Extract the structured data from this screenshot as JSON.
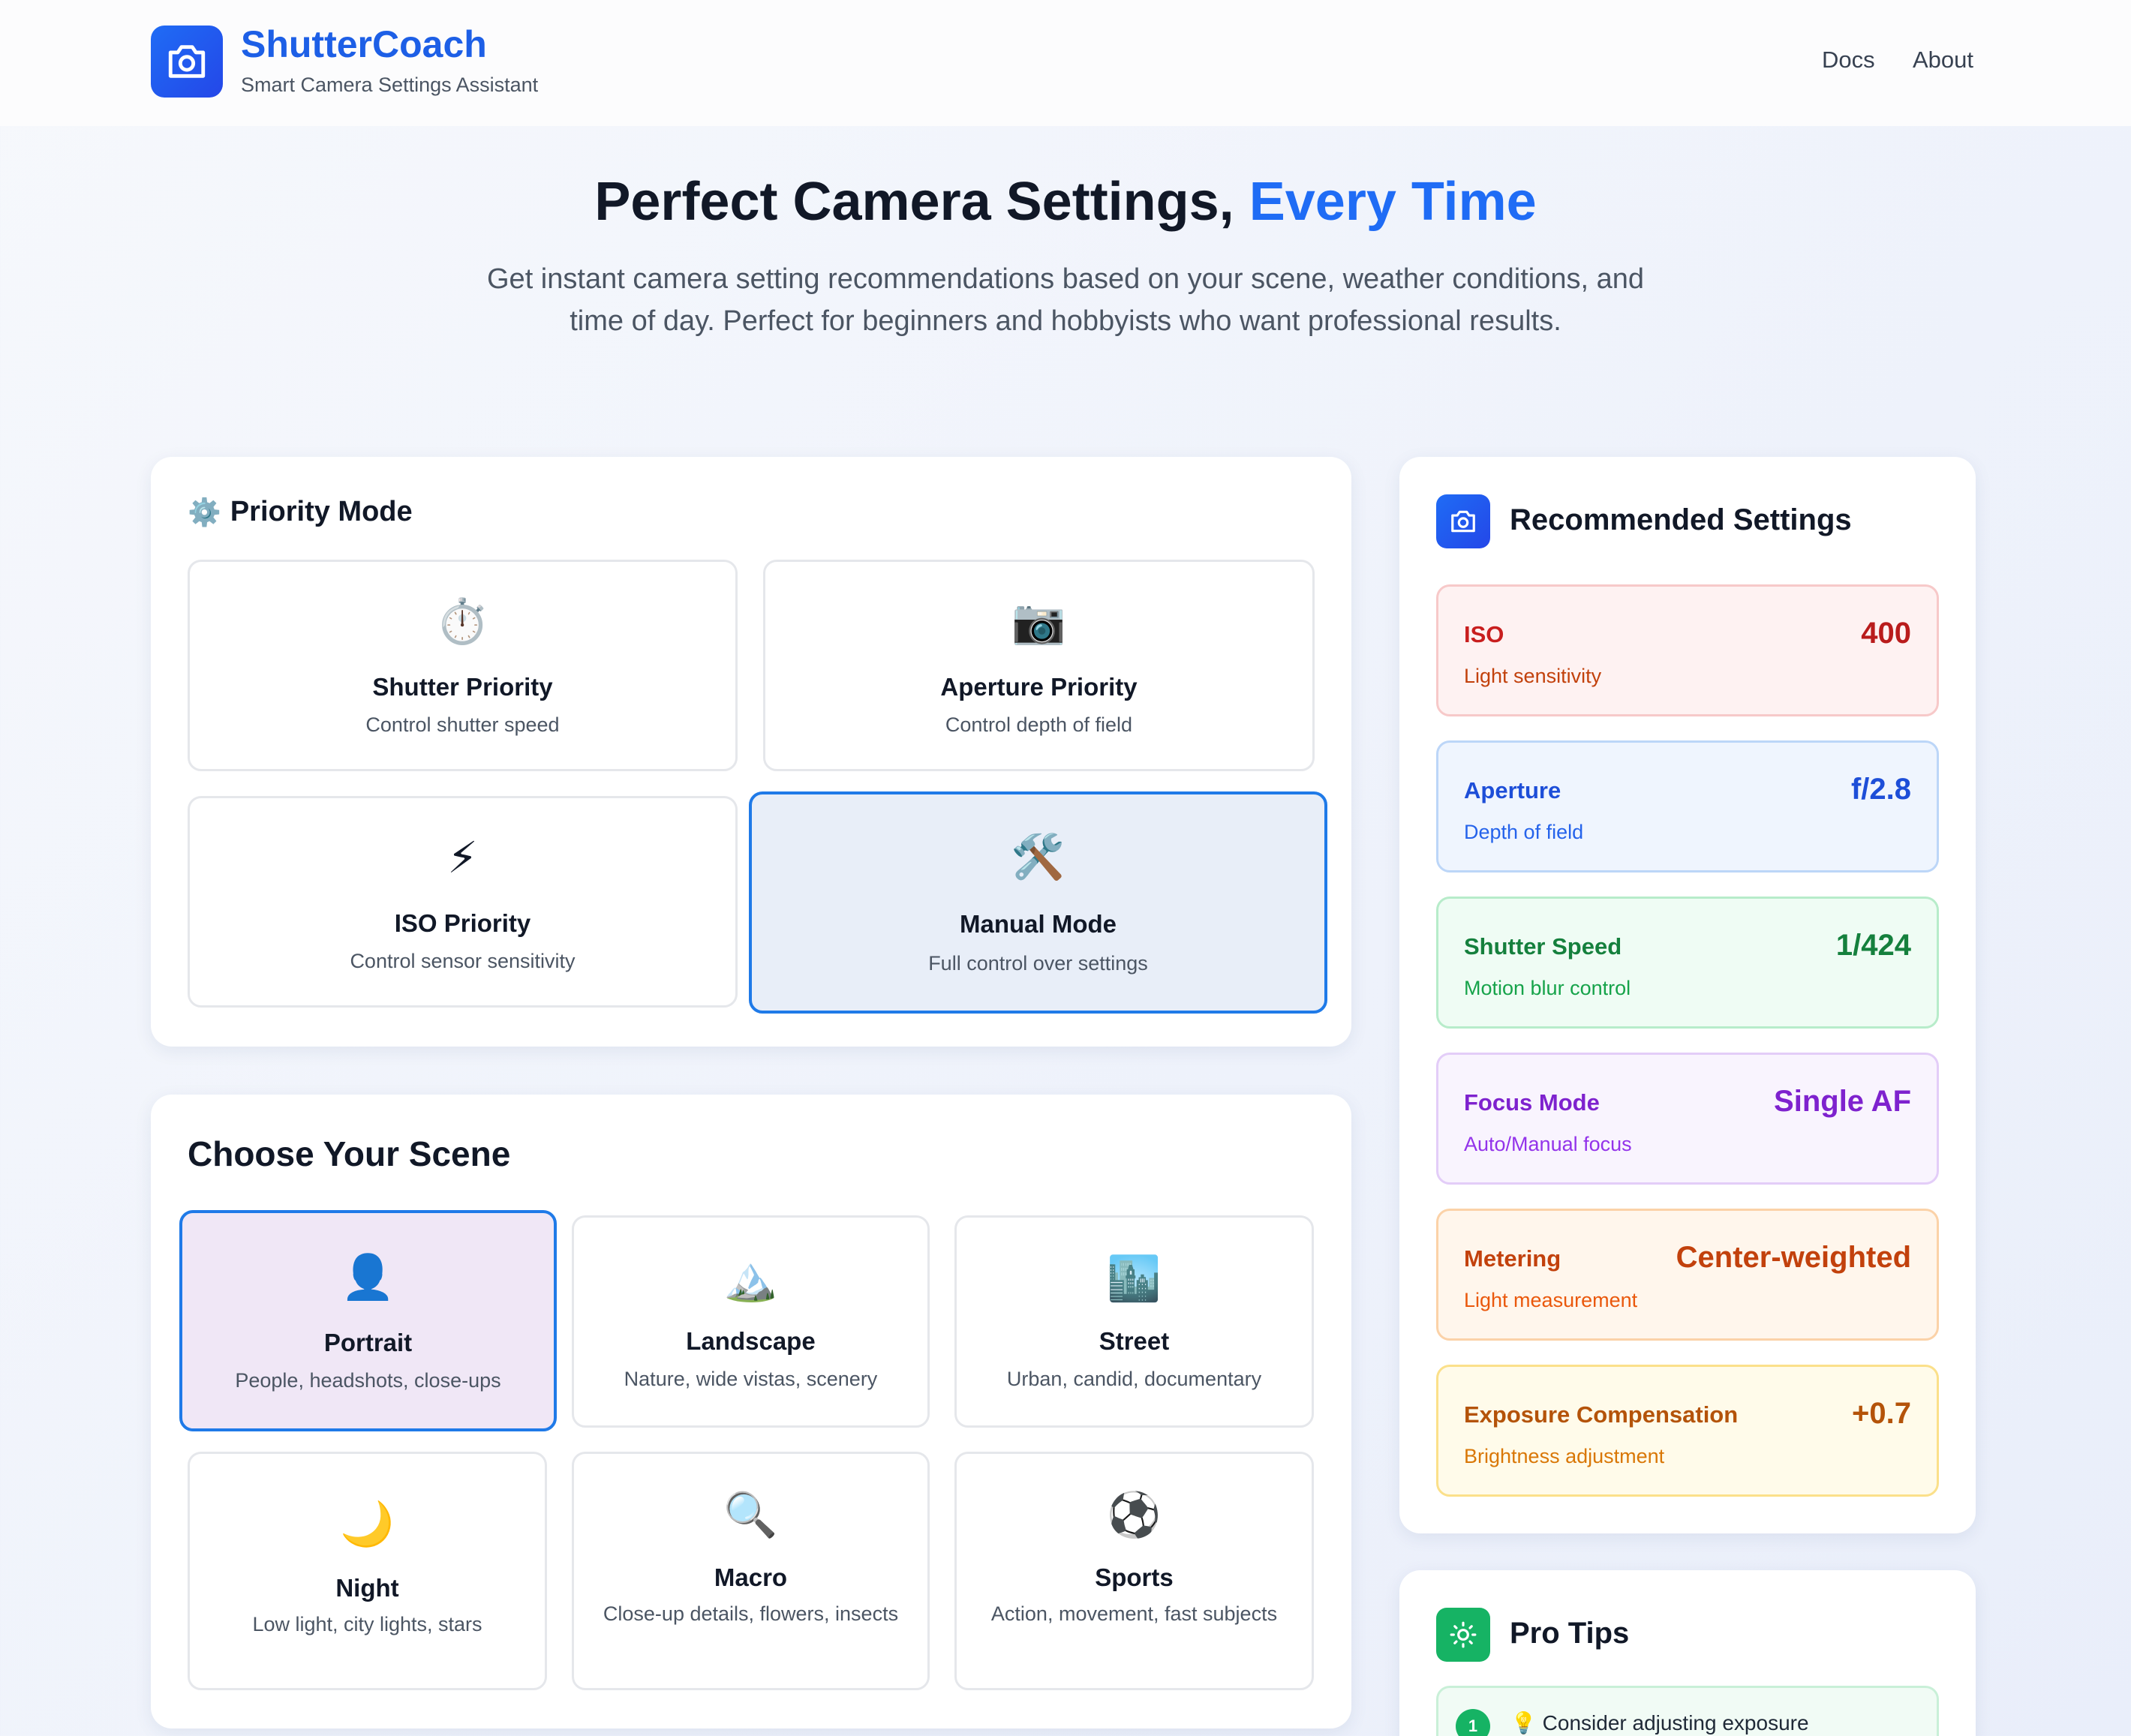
{
  "header": {
    "brand_name": "ShutterCoach",
    "brand_tagline": "Smart Camera Settings Assistant",
    "nav": [
      "Docs",
      "About"
    ]
  },
  "hero": {
    "title_main": "Perfect Camera Settings, ",
    "title_accent": "Every Time",
    "subtitle": "Get instant camera setting recommendations based on your scene, weather conditions, and time of day. Perfect for beginners and hobbyists who want professional results."
  },
  "priority": {
    "title": "Priority Mode",
    "title_icon": "⚙️",
    "modes": [
      {
        "icon": "⏱️",
        "title": "Shutter Priority",
        "subtitle": "Control shutter speed",
        "selected": false
      },
      {
        "icon": "📷",
        "title": "Aperture Priority",
        "subtitle": "Control depth of field",
        "selected": false
      },
      {
        "icon": "⚡",
        "title": "ISO Priority",
        "subtitle": "Control sensor sensitivity",
        "selected": false
      },
      {
        "icon": "🛠️",
        "title": "Manual Mode",
        "subtitle": "Full control over settings",
        "selected": true
      }
    ]
  },
  "scene": {
    "title": "Choose Your Scene",
    "scenes": [
      {
        "icon": "👤",
        "title": "Portrait",
        "subtitle": "People, headshots, close-ups",
        "selected": true
      },
      {
        "icon": "🏔️",
        "title": "Landscape",
        "subtitle": "Nature, wide vistas, scenery",
        "selected": false
      },
      {
        "icon": "🏙️",
        "title": "Street",
        "subtitle": "Urban, candid, documentary",
        "selected": false
      },
      {
        "icon": "🌙",
        "title": "Night",
        "subtitle": "Low light, city lights, stars",
        "selected": false
      },
      {
        "icon": "🔍",
        "title": "Macro",
        "subtitle": "Close-up details, flowers, insects",
        "selected": false
      },
      {
        "icon": "⚽",
        "title": "Sports",
        "subtitle": "Action, movement, fast subjects",
        "selected": false
      }
    ]
  },
  "settings": {
    "title": "Recommended Settings",
    "items": [
      {
        "label": "ISO",
        "value": "400",
        "desc": "Light sensitivity",
        "bg": "#fef2f2",
        "border": "#f7c9c9",
        "label_color": "#c81e1e",
        "value_color": "#b91c1c",
        "desc_color": "#c2410c"
      },
      {
        "label": "Aperture",
        "value": "f/2.8",
        "desc": "Depth of field",
        "bg": "#eff5fe",
        "border": "#bcd6f8",
        "label_color": "#1d4ed8",
        "value_color": "#1d4ed8",
        "desc_color": "#2563eb"
      },
      {
        "label": "Shutter Speed",
        "value": "1/424",
        "desc": "Motion blur control",
        "bg": "#effcf4",
        "border": "#b7ecca",
        "label_color": "#15803d",
        "value_color": "#15803d",
        "desc_color": "#16a34a"
      },
      {
        "label": "Focus Mode",
        "value": "Single AF",
        "desc": "Auto/Manual focus",
        "bg": "#f9f4fe",
        "border": "#e3cdf8",
        "label_color": "#7e22ce",
        "value_color": "#7e22ce",
        "desc_color": "#9333ea"
      },
      {
        "label": "Metering",
        "value": "Center-weighted",
        "desc": "Light measurement",
        "bg": "#fff6ec",
        "border": "#fbd2a8",
        "label_color": "#c2410c",
        "value_color": "#c2410c",
        "desc_color": "#ea580c"
      },
      {
        "label": "Exposure Compensation",
        "value": "+0.7",
        "desc": "Brightness adjustment",
        "bg": "#fffbea",
        "border": "#fbe08a",
        "label_color": "#b45309",
        "value_color": "#b45309",
        "desc_color": "#d97706"
      }
    ]
  },
  "tips": {
    "title": "Pro Tips",
    "items": [
      {
        "num": "1",
        "icon": "💡",
        "text": "Consider adjusting exposure"
      }
    ]
  }
}
